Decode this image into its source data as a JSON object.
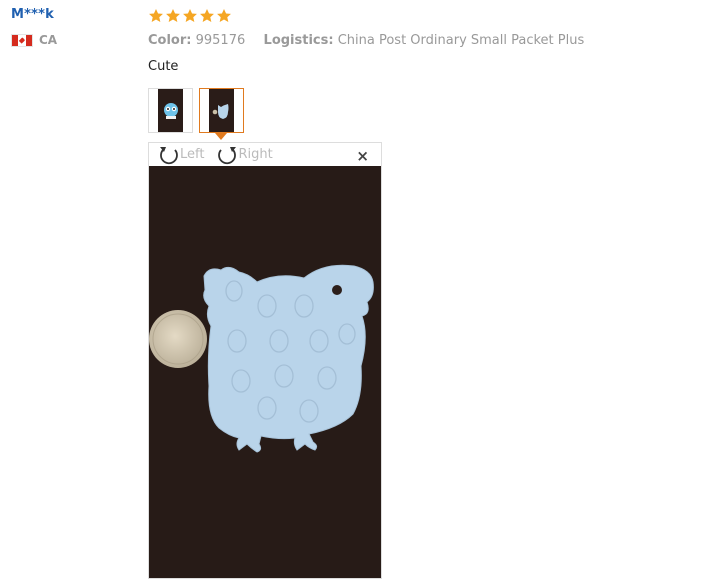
{
  "reviewer": {
    "name": "M***k",
    "country_code": "CA",
    "flag_icon": "canada-flag-icon"
  },
  "review": {
    "rating": 5,
    "star_color": "#f5a623",
    "color_label": "Color:",
    "color_value": "995176",
    "logistics_label": "Logistics:",
    "logistics_value": "China Post Ordinary Small Packet Plus",
    "comment": "Cute"
  },
  "images": {
    "thumbnails": [
      {
        "name": "thumbnail-1",
        "active": false
      },
      {
        "name": "thumbnail-2",
        "active": true
      }
    ]
  },
  "viewer": {
    "rotate_left_label": "Left",
    "rotate_right_label": "Right",
    "close_glyph": "×",
    "icons": [
      "rotate-left-icon",
      "rotate-right-icon",
      "close-icon"
    ]
  }
}
